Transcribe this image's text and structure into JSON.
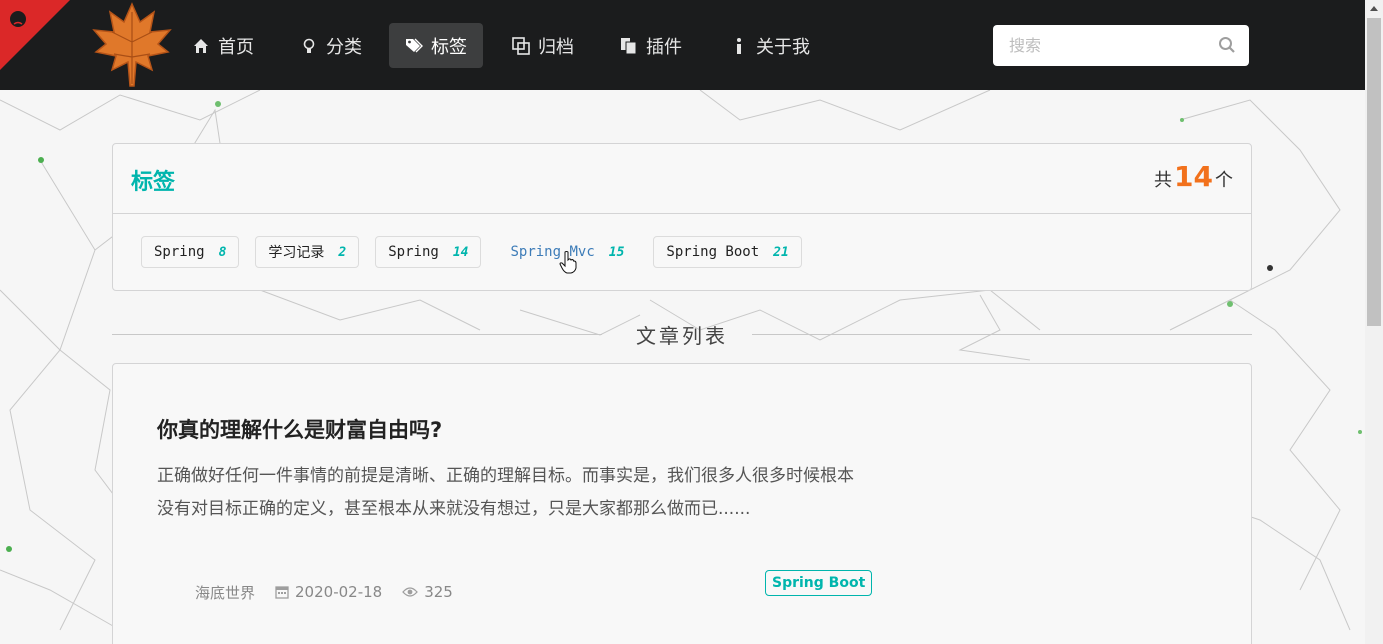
{
  "nav": {
    "items": [
      {
        "label": "首页",
        "icon": "home-icon"
      },
      {
        "label": "分类",
        "icon": "lightbulb-icon"
      },
      {
        "label": "标签",
        "icon": "tags-icon",
        "active": true
      },
      {
        "label": "归档",
        "icon": "clone-icon"
      },
      {
        "label": "插件",
        "icon": "copy-icon"
      },
      {
        "label": "关于我",
        "icon": "info-icon"
      }
    ],
    "search_placeholder": "搜索"
  },
  "tag_panel": {
    "title": "标签",
    "count_prefix": "共",
    "count": "14",
    "count_suffix": "个",
    "tags": [
      {
        "name": "Spring",
        "count": "8"
      },
      {
        "name": "学习记录",
        "count": "2"
      },
      {
        "name": "Spring",
        "count": "14"
      },
      {
        "name": "Spring Mvc",
        "count": "15",
        "active": true
      },
      {
        "name": "Spring Boot",
        "count": "21"
      }
    ]
  },
  "section": {
    "label": "文章列表"
  },
  "article": {
    "title": "你真的理解什么是财富自由吗?",
    "summary": "正确做好任何一件事情的前提是清晰、正确的理解目标。而事实是，我们很多人很多时候根本没有对目标正确的定义，甚至根本从来就没有想过，只是大家都那么做而已......",
    "author": "海底世界",
    "date": "2020-02-18",
    "views": "325",
    "tag": "Spring Boot"
  },
  "colors": {
    "accent": "#00b5ad",
    "count_orange": "#f2711c",
    "navbar": "#1b1c1d"
  }
}
